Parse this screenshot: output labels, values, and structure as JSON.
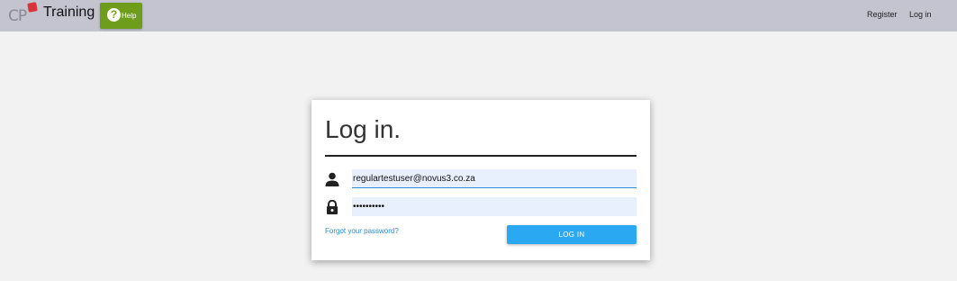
{
  "header": {
    "logo_text": "CP",
    "brand": "Training",
    "help_label": "Help",
    "help_icon": "question-circle-icon",
    "nav": {
      "register": "Register",
      "login": "Log in"
    },
    "background_color": "#c4c4d0",
    "help_color": "#6e9d1c"
  },
  "login_form": {
    "title": "Log in.",
    "email_value": "regulartestuser@novus3.co.za",
    "password_value": "••••••••••",
    "forgot_password": "Forgot your password?",
    "submit_label": "LOG IN",
    "user_icon": "user-icon",
    "lock_icon": "lock-icon",
    "accent_color": "#2aa8f2"
  }
}
